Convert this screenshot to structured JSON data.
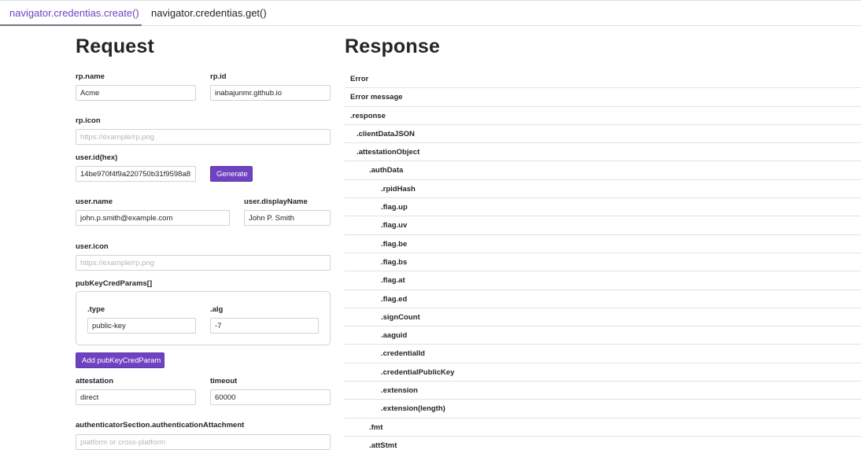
{
  "tabs": [
    {
      "label": "navigator.credentias.create()"
    },
    {
      "label": "navigator.credentias.get()"
    }
  ],
  "request": {
    "title": "Request",
    "rp_name": {
      "label": "rp.name",
      "value": "Acme"
    },
    "rp_id": {
      "label": "rp.id",
      "value": "inabajunmr.github.io"
    },
    "rp_icon": {
      "label": "rp.icon",
      "placeholder": "https://example/rp.png"
    },
    "user_id": {
      "label": "user.id(hex)",
      "value": "14be970f4f9a220750b31f9598a8",
      "button": "Generate"
    },
    "user_name": {
      "label": "user.name",
      "value": "john.p.smith@example.com"
    },
    "user_display_name": {
      "label": "user.displayName",
      "value": "John P. Smith"
    },
    "user_icon": {
      "label": "user.icon",
      "placeholder": "https://example/rp.png"
    },
    "pub_key_cred_params": {
      "label": "pubKeyCredParams[]",
      "type_label": ".type",
      "type_value": "public-key",
      "alg_label": ".alg",
      "alg_value": "-7",
      "add_button": "Add pubKeyCredParam"
    },
    "attestation": {
      "label": "attestation",
      "value": "direct"
    },
    "timeout": {
      "label": "timeout",
      "value": "60000"
    },
    "authenticator_attachment": {
      "label": "authenticatorSection.authenticationAttachment",
      "placeholder": "platform or cross-platform"
    }
  },
  "response": {
    "title": "Response",
    "rows": [
      {
        "label": "Error",
        "level": 0
      },
      {
        "label": "Error message",
        "level": 0
      },
      {
        "label": ".response",
        "level": 0
      },
      {
        "label": ".clientDataJSON",
        "level": 1
      },
      {
        "label": ".attestationObject",
        "level": 1
      },
      {
        "label": ".authData",
        "level": 2
      },
      {
        "label": ".rpidHash",
        "level": 3
      },
      {
        "label": ".flag.up",
        "level": 3
      },
      {
        "label": ".flag.uv",
        "level": 3
      },
      {
        "label": ".flag.be",
        "level": 3
      },
      {
        "label": ".flag.bs",
        "level": 3
      },
      {
        "label": ".flag.at",
        "level": 3
      },
      {
        "label": ".flag.ed",
        "level": 3
      },
      {
        "label": ".signCount",
        "level": 3
      },
      {
        "label": ".aaguid",
        "level": 3
      },
      {
        "label": ".credentialId",
        "level": 3
      },
      {
        "label": ".credentialPublicKey",
        "level": 3
      },
      {
        "label": ".extension",
        "level": 3
      },
      {
        "label": ".extension(length)",
        "level": 3
      },
      {
        "label": ".fmt",
        "level": 2
      },
      {
        "label": ".attStmt",
        "level": 2
      }
    ]
  },
  "colors": {
    "accent": "#6f42c1",
    "border": "#ced4da",
    "divider": "#dee2e6"
  }
}
